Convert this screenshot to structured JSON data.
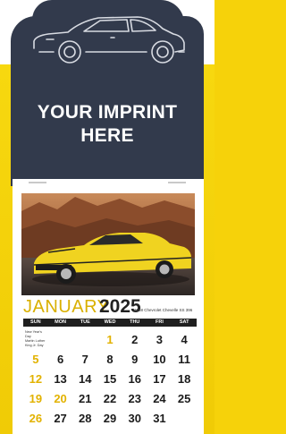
{
  "header": {
    "imprint_line1": "YOUR IMPRINT",
    "imprint_line2": "HERE"
  },
  "photo": {
    "caption": "1968 Chevrolet Chevelle SS 396"
  },
  "calendar": {
    "month": "JANUARY",
    "year": "2025",
    "days_of_week": [
      "SUN",
      "MON",
      "TUE",
      "WED",
      "THU",
      "FRI",
      "SAT"
    ],
    "note_lines": [
      "New Year's Day",
      "Martin Luther King Jr. Day"
    ],
    "weeks": [
      [
        "",
        "",
        "",
        "1",
        "2",
        "3",
        "4"
      ],
      [
        "5",
        "6",
        "7",
        "8",
        "9",
        "10",
        "11"
      ],
      [
        "12",
        "13",
        "14",
        "15",
        "16",
        "17",
        "18"
      ],
      [
        "19",
        "20",
        "21",
        "22",
        "23",
        "24",
        "25"
      ],
      [
        "26",
        "27",
        "28",
        "29",
        "30",
        "31",
        ""
      ]
    ]
  },
  "colors": {
    "background": "#f6d20a",
    "panel": "#323a4c",
    "accent": "#e2b200",
    "car": "#f0d320"
  }
}
